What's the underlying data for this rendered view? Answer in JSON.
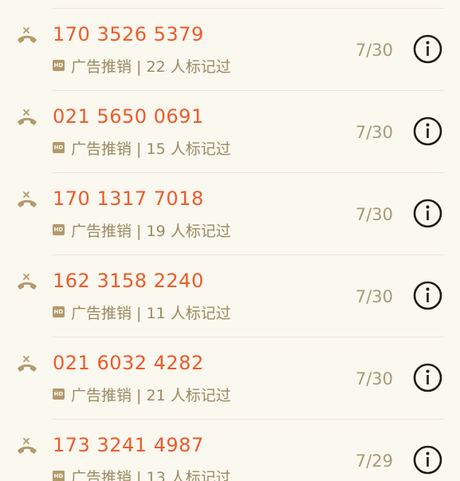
{
  "calls": [
    {
      "number": "170 3526 5379",
      "badge": "HD",
      "tag": "广告推销 | 22 人标记过",
      "date": "7/30"
    },
    {
      "number": "021 5650 0691",
      "badge": "HD",
      "tag": "广告推销 | 15 人标记过",
      "date": "7/30"
    },
    {
      "number": "170 1317 7018",
      "badge": "HD",
      "tag": "广告推销 | 19 人标记过",
      "date": "7/30"
    },
    {
      "number": "162 3158 2240",
      "badge": "HD",
      "tag": "广告推销 | 11 人标记过",
      "date": "7/30"
    },
    {
      "number": "021 6032 4282",
      "badge": "HD",
      "tag": "广告推销 | 21 人标记过",
      "date": "7/30"
    },
    {
      "number": "173 3241 4987",
      "badge": "HD",
      "tag": "广告推销 | 13 人标记过",
      "date": "7/29"
    }
  ],
  "colors": {
    "number": "#ef5a2a",
    "tag": "#9b8a63",
    "date": "#a79a7a",
    "icon": "#b29a6c",
    "background": "#fbf8ef"
  },
  "icons": {
    "call_type": "missed-call-icon",
    "info": "info-icon"
  }
}
